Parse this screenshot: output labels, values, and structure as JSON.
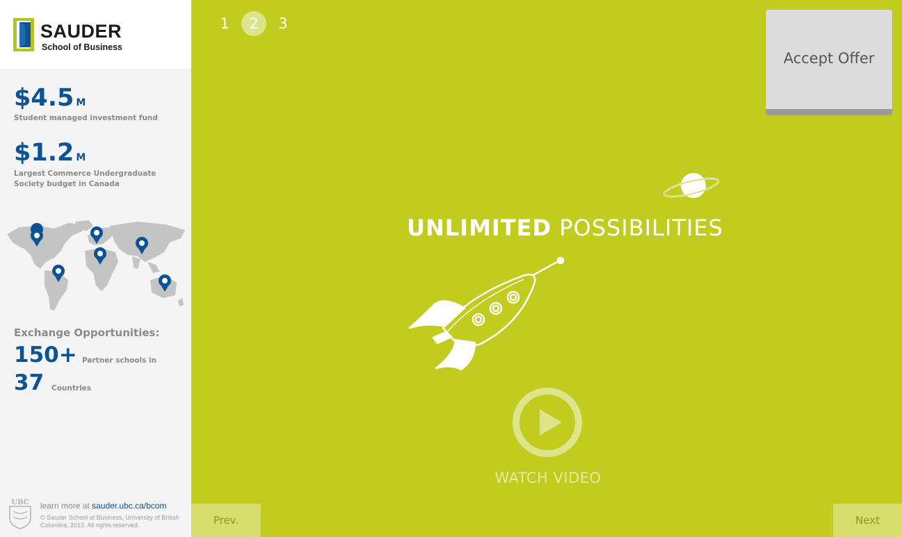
{
  "brand": {
    "name": "SAUDER",
    "subtitle": "School of Business"
  },
  "sidebar": {
    "stats": [
      {
        "value": "$4.5",
        "unit": "M",
        "label": "Student managed investment fund"
      },
      {
        "value": "$1.2",
        "unit": "M",
        "label": "Largest Commerce Undergraduate Society budget in Canada"
      }
    ],
    "exchange": {
      "title": "Exchange Opportunities:",
      "partners_value": "150+",
      "partners_label": "Partner schools in",
      "countries_value": "37",
      "countries_label": "Countries"
    },
    "footer": {
      "learn_prefix": "learn more at",
      "link": "sauder.ubc.ca/bcom",
      "copyright": "© Sauder School of Business, University of British Columbia, 2012. All rights reserved.",
      "ubc_mark": "UBC"
    }
  },
  "pager": {
    "pages": [
      "1",
      "2",
      "3"
    ],
    "active": "2"
  },
  "accept_button": "Accept Offer",
  "hero": {
    "title_bold": "UNLIMITED",
    "title_light": "POSSIBILITIES",
    "watch_label": "WATCH VIDEO"
  },
  "nav": {
    "prev": "Prev.",
    "next": "Next"
  },
  "colors": {
    "background": "#c2cc1f",
    "accent_blue": "#0b5394",
    "sidebar_bg": "#f4f4f4"
  },
  "icons": [
    "sauder-logo-icon",
    "world-map-icon",
    "map-pin-icon",
    "planet-icon",
    "rocket-icon",
    "play-icon",
    "ubc-crest-icon"
  ]
}
